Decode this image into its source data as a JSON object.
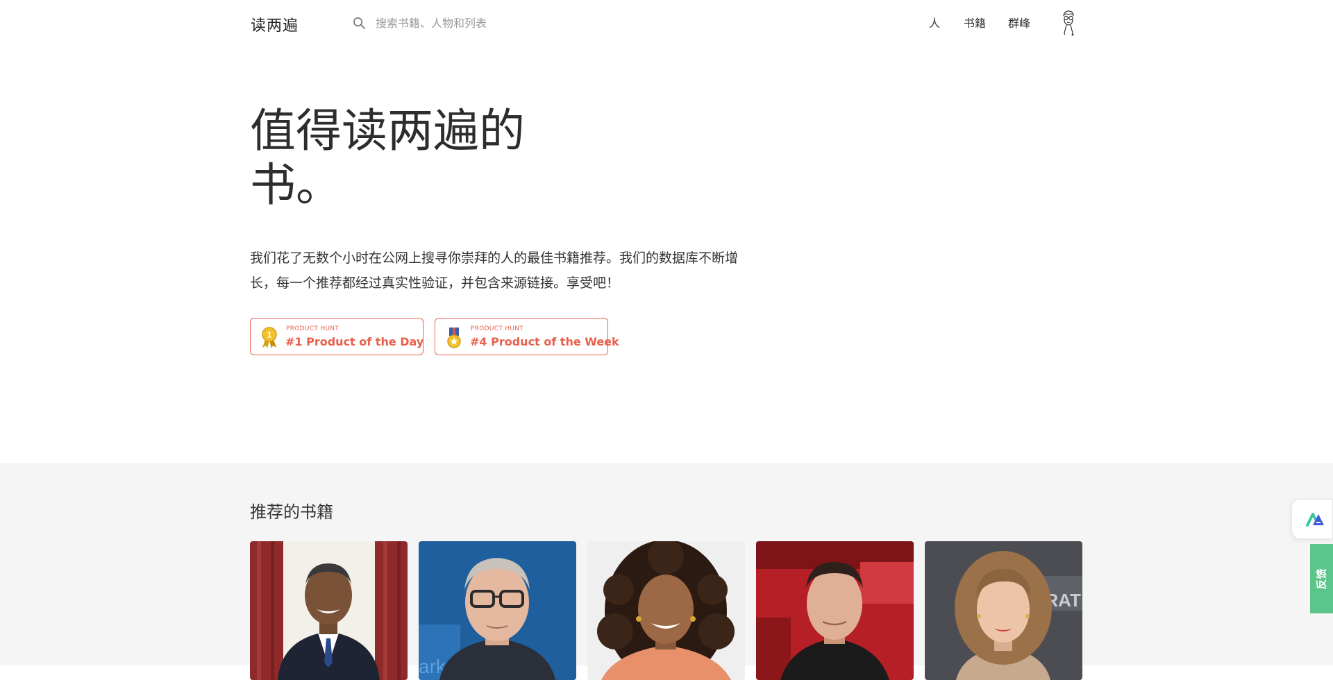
{
  "header": {
    "logo": "读两遍",
    "search_placeholder": "搜索书籍、人物和列表",
    "nav": [
      {
        "label": "人"
      },
      {
        "label": "书籍"
      },
      {
        "label": "群峰"
      }
    ]
  },
  "hero": {
    "title": "值得读两遍的书。",
    "description": "我们花了无数个小时在公网上搜寻你崇拜的人的最佳书籍推荐。我们的数据库不断增长，每一个推荐都经过真实性验证，并包含来源链接。享受吧！",
    "badges": [
      {
        "small": "PRODUCT HUNT",
        "big": "#1 Product of the Day"
      },
      {
        "small": "PRODUCT HUNT",
        "big": "#4 Product of the Week"
      }
    ]
  },
  "recommended": {
    "title": "推荐的书籍",
    "cards": [
      {
        "bg": "#8e2a2a"
      },
      {
        "bg": "#1f5f9e"
      },
      {
        "bg": "#efefef"
      },
      {
        "bg": "#b51f25"
      },
      {
        "bg": "#4b4d53"
      }
    ],
    "card5_sign_text": "ERAT"
  },
  "widgets": {
    "feedback_label": "反馈"
  },
  "colors": {
    "accent": "#e8604c",
    "feedback": "#5cc68a",
    "section_bg": "#f5f5f5"
  }
}
